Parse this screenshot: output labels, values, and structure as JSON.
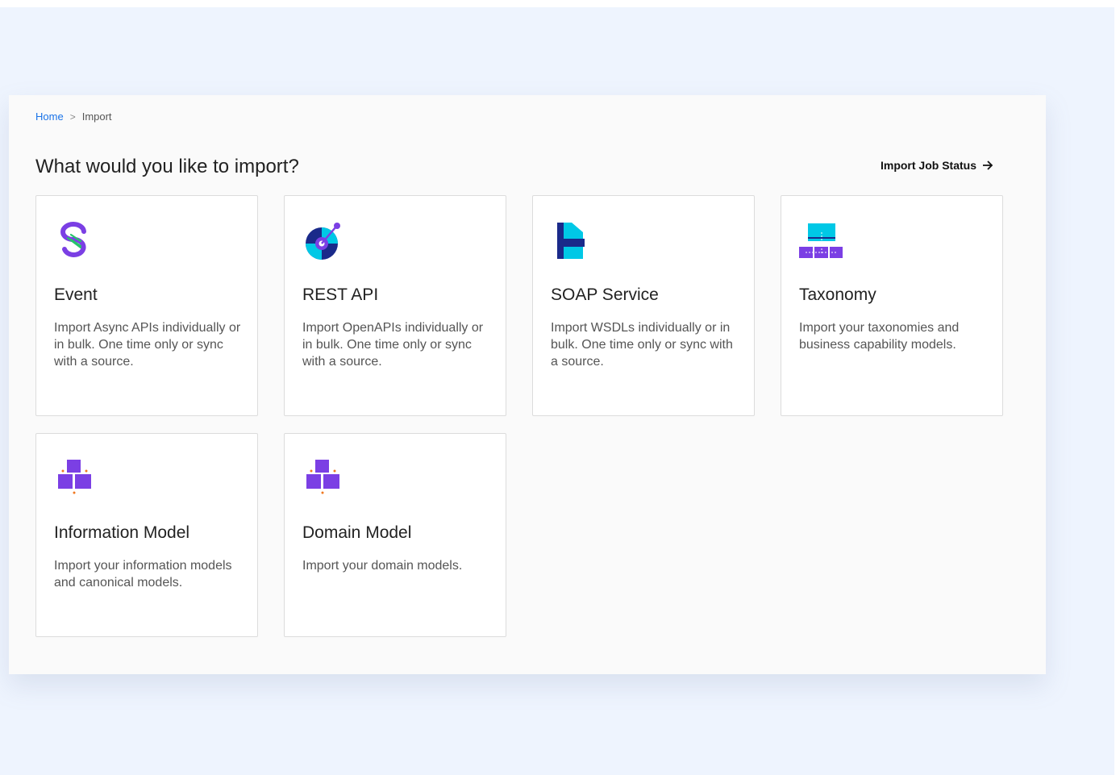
{
  "breadcrumb": {
    "home": "Home",
    "separator": ">",
    "current": "Import"
  },
  "page": {
    "heading": "What would you like to import?",
    "job_status_label": "Import Job Status"
  },
  "cards": [
    {
      "title": "Event",
      "description": "Import Async APIs individually or in bulk. One time only or sync with a source.",
      "icon": "event-icon"
    },
    {
      "title": "REST API",
      "description": "Import OpenAPIs individually or in bulk. One time only or sync with a source.",
      "icon": "rest-api-icon"
    },
    {
      "title": "SOAP Service",
      "description": "Import WSDLs individually or in bulk. One time only or sync with a source.",
      "icon": "soap-service-icon"
    },
    {
      "title": "Taxonomy",
      "description": "Import your taxonomies and business capability models.",
      "icon": "taxonomy-icon"
    },
    {
      "title": "Information Model",
      "description": "Import your information models and canonical models.",
      "icon": "information-model-icon"
    },
    {
      "title": "Domain Model",
      "description": "Import your domain models.",
      "icon": "domain-model-icon"
    }
  ],
  "colors": {
    "link": "#1a73e8",
    "purple": "#7b3fe4",
    "cyan": "#00c8e6",
    "navy": "#1a2a8a",
    "green": "#27c46a",
    "orange": "#f07820",
    "background": "#eef4fe"
  }
}
